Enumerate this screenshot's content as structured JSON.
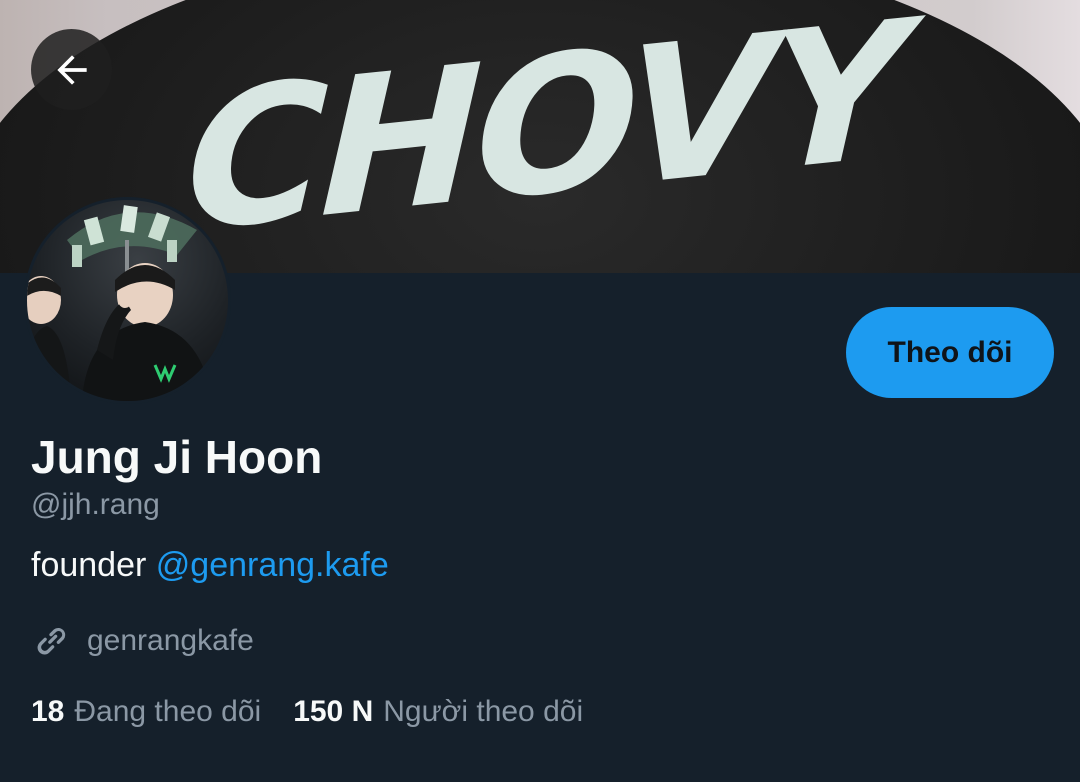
{
  "banner": {
    "shirt_text": "CHOVY"
  },
  "navigation": {
    "back_icon": "arrow-left-icon"
  },
  "profile": {
    "display_name": "Jung Ji Hoon",
    "handle": "@jjh.rang",
    "bio_text": "founder ",
    "bio_mention": "@genrang.kafe",
    "website": "genrangkafe",
    "website_icon": "link-icon"
  },
  "actions": {
    "follow_label": "Theo dõi"
  },
  "stats": {
    "following_count": "18",
    "following_label": "Đang theo dõi",
    "followers_count": "150 N",
    "followers_label": "Người theo dõi"
  },
  "colors": {
    "background": "#15202b",
    "accent": "#1d9bf0",
    "secondary_text": "#8b98a5",
    "primary_text": "#f7f9f9"
  }
}
